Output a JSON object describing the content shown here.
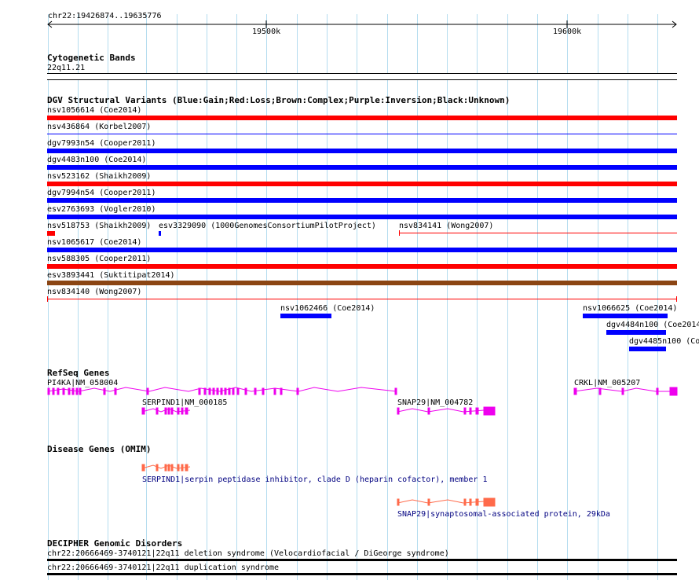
{
  "ruler": {
    "location": "chr22:19426874..19635776",
    "ticks": [
      "19500k",
      "19600k"
    ]
  },
  "cytoband": {
    "title": "Cytogenetic Bands",
    "band": "22q11.21"
  },
  "dgv": {
    "title": "DGV Structural Variants (Blue:Gain;Red:Loss;Brown:Complex;Purple:Inversion;Black:Unknown)",
    "colors": {
      "gain": "#0000ff",
      "loss": "#ff0000",
      "complex": "#8b4513",
      "unknown": "#000000"
    },
    "rows": [
      {
        "label": "nsv1056614 (Coe2014)"
      },
      {
        "label": "nsv436864 (Korbel2007)"
      },
      {
        "label": "dgv7993n54 (Cooper2011)"
      },
      {
        "label": "dgv4483n100 (Coe2014)"
      },
      {
        "label": "nsv523162 (Shaikh2009)"
      },
      {
        "label": "dgv7994n54 (Cooper2011)"
      },
      {
        "label": "esv2763693 (Vogler2010)"
      },
      {
        "label": "nsv518753 (Shaikh2009)"
      },
      {
        "label": "esv3329090 (1000GenomesConsortiumPilotProject)"
      },
      {
        "label": "nsv834141 (Wong2007)"
      },
      {
        "label": "nsv1065617 (Coe2014)"
      },
      {
        "label": "nsv588305 (Cooper2011)"
      },
      {
        "label": "esv3893441 (Suktitipat2014)"
      },
      {
        "label": "nsv834140 (Wong2007)"
      },
      {
        "label": "nsv1062466 (Coe2014)"
      },
      {
        "label": "nsv1066625 (Coe2014)"
      },
      {
        "label": "dgv4484n100 (Coe2014)"
      },
      {
        "label": "dgv4485n100 (Co"
      }
    ]
  },
  "refseq": {
    "title": "RefSeq Genes",
    "genes": [
      {
        "label": "PI4KA|NM_058004"
      },
      {
        "label": "SERPIND1|NM_000185"
      },
      {
        "label": "SNAP29|NM_004782"
      },
      {
        "label": "CRKL|NM_005207"
      }
    ]
  },
  "omim": {
    "title": "Disease Genes (OMIM)",
    "genes": [
      {
        "label": "SERPIND1|serpin peptidase inhibitor, clade D (heparin cofactor), member 1"
      },
      {
        "label": "SNAP29|synaptosomal-associated protein, 29kDa"
      }
    ]
  },
  "decipher": {
    "title": "DECIPHER Genomic Disorders",
    "items": [
      {
        "label": "chr22:20666469-3740121|22q11 deletion syndrome (Velocardiofacial / DiGeorge syndrome)"
      },
      {
        "label": "chr22:20666469-3740121|22q11 duplication syndrome"
      }
    ]
  }
}
